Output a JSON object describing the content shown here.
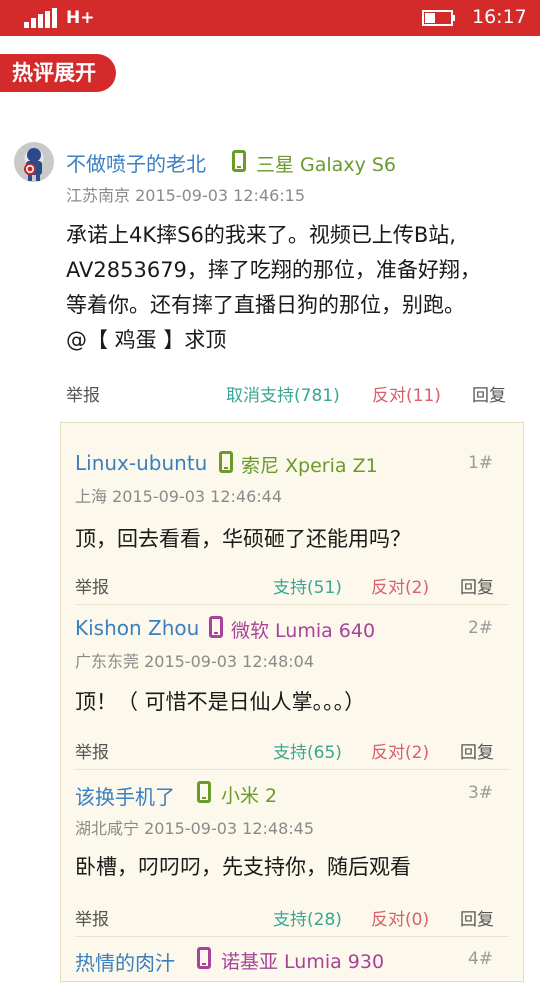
{
  "status": {
    "network": "H+",
    "time": "16:17"
  },
  "hot_tag": "热评展开",
  "comment": {
    "username": "不做喷子的老北",
    "device": "三星 Galaxy S6",
    "location_time": "江苏南京 2015-09-03 12:46:15",
    "lines": [
      "承诺上4K摔S6的我来了。视频已上传B站,",
      "AV2853679，摔了吃翔的那位，准备好翔，",
      "等着你。还有摔了直播日狗的那位，别跑。",
      "@【 鸡蛋 】求顶"
    ],
    "actions": {
      "report": "举报",
      "support": "取消支持(781)",
      "oppose": "反对(11)",
      "reply": "回复"
    }
  },
  "replies": [
    {
      "username": "Linux-ubuntu",
      "device": "索尼 Xperia Z1",
      "device_color": "#6a9a2a",
      "floor": "1#",
      "location_time": "上海 2015-09-03 12:46:44",
      "text": "顶，回去看看，华硕砸了还能用吗？",
      "actions": {
        "report": "举报",
        "support": "支持(51)",
        "oppose": "反对(2)",
        "reply": "回复"
      }
    },
    {
      "username": "Kishon Zhou",
      "device": "微软 Lumia 640",
      "device_color": "#a8429a",
      "floor": "2#",
      "location_time": "广东东莞 2015-09-03 12:48:04",
      "text": "顶！（ 可惜不是日仙人掌。。。）",
      "actions": {
        "report": "举报",
        "support": "支持(65)",
        "oppose": "反对(2)",
        "reply": "回复"
      }
    },
    {
      "username": "该换手机了",
      "device": "小米 2",
      "device_color": "#6a9a2a",
      "floor": "3#",
      "location_time": "湖北咸宁 2015-09-03 12:48:45",
      "text": "卧槽，叼叼叼，先支持你，随后观看",
      "actions": {
        "report": "举报",
        "support": "支持(28)",
        "oppose": "反对(0)",
        "reply": "回复"
      }
    },
    {
      "username": "热情的肉汁",
      "device": "诺基亚 Lumia 930",
      "device_color": "#a8429a",
      "floor": "4#"
    }
  ]
}
